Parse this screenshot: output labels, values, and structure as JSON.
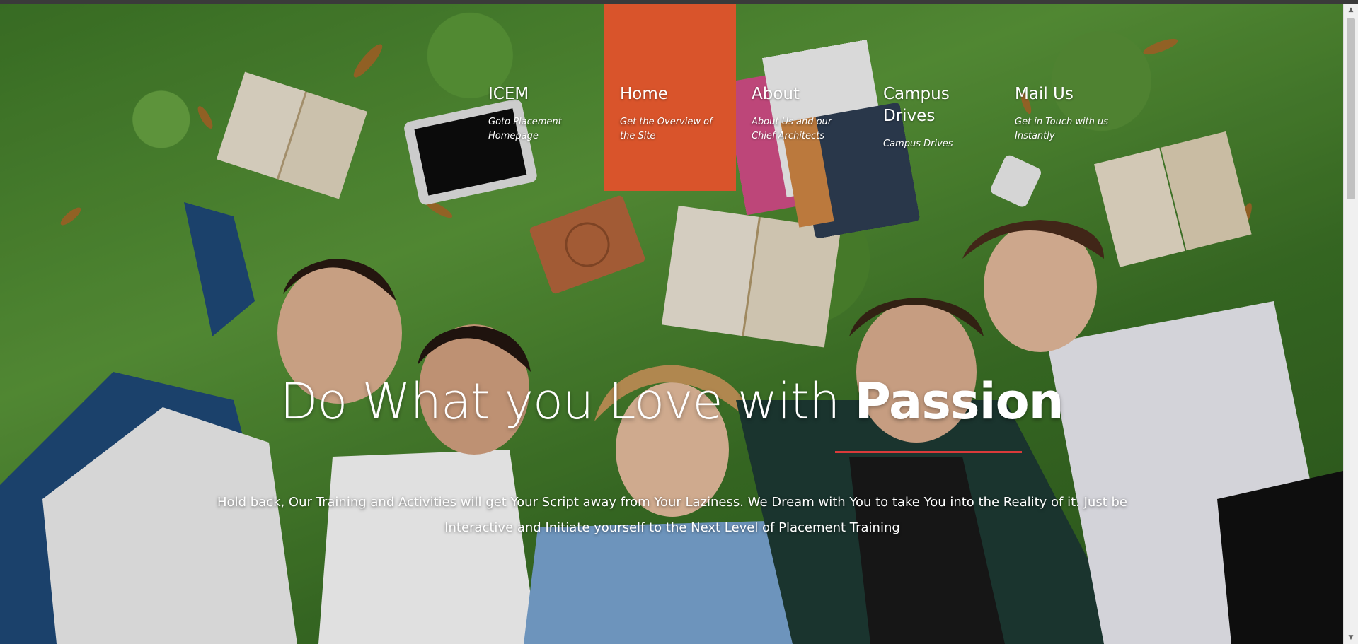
{
  "nav": {
    "items": [
      {
        "title": "ICEM",
        "desc": "Goto Placement Homepage"
      },
      {
        "title": "Home",
        "desc": "Get the Overview of the Site"
      },
      {
        "title": "About",
        "desc": "About Us and our Chief Architects"
      },
      {
        "title": "Campus Drives",
        "desc": "Campus Drives"
      },
      {
        "title": "Mail Us",
        "desc": "Get in Touch with us Instantly"
      }
    ],
    "active_color": "#d9542b"
  },
  "hero": {
    "headline_light": "Do What you Love with ",
    "headline_bold": "Passion",
    "underline_color": "#d93a3a",
    "tagline": "Hold back, Our Training and Activities will get Your Script away from Your Laziness. We Dream with You to take You into the Reality of it. Just be Interactive and Initiate yourself to the Next Level of Placement Training"
  }
}
